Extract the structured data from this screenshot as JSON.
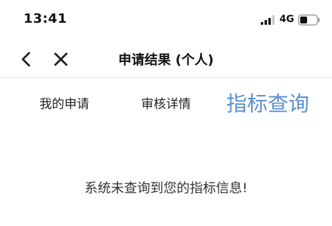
{
  "status_bar": {
    "time": "13:41",
    "network": "4G",
    "icons": [
      "signal-icon",
      "battery-icon"
    ]
  },
  "nav": {
    "title": "申请结果 (个人)",
    "icons": [
      "chevron-left-icon",
      "close-icon"
    ]
  },
  "tabs": [
    {
      "label": "我的申请",
      "active": false
    },
    {
      "label": "审核详情",
      "active": false
    },
    {
      "label": "指标查询",
      "active": true
    }
  ],
  "main": {
    "empty_message": "系统未查询到您的指标信息!"
  },
  "colors": {
    "active_tab": "#5b8fd0",
    "text": "#222222",
    "divider": "#e3e3e3"
  }
}
